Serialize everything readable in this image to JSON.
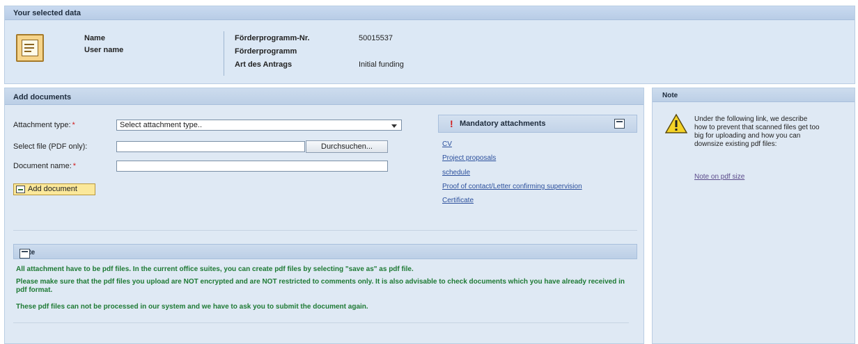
{
  "selected_data": {
    "title": "Your selected data",
    "labels": {
      "name": "Name",
      "user_name": "User name",
      "program_nr": "Förderprogramm-Nr.",
      "program": "Förderprogramm",
      "request_type": "Art des Antrags"
    },
    "values": {
      "program_nr": "50015537",
      "request_type": "Initial funding"
    },
    "icon": "application-form-icon"
  },
  "add_documents": {
    "title": "Add documents",
    "attachment_type_label": "Attachment type:",
    "attachment_type_value": "Select attachment type..",
    "select_file_label": "Select file (PDF only):",
    "browse_label": "Durchsuchen...",
    "document_name_label": "Document name:",
    "required_marker": "*",
    "add_document_label": "Add document"
  },
  "mandatory": {
    "marker": "!",
    "title": "Mandatory attachments",
    "links": [
      "CV",
      "Project proposals",
      "schedule",
      "Proof of contact/Letter confirming supervision",
      "Certificate"
    ]
  },
  "note_inner": {
    "title": "Note",
    "lines": [
      "All attachment have to be pdf files. In the current office suites, you can create pdf files by selecting \"save as\" as pdf file.",
      "Please make sure that the pdf files you upload are NOT encrypted and are NOT restricted to comments only. It is also advisable to check documents which you have already received in pdf format.",
      "These pdf files can not be processed in our system and we have to ask you to submit the document again."
    ]
  },
  "note_right": {
    "title": "Note",
    "text": "Under the following link, we describe how to prevent that scanned files get too big for uploading and how you can downsize existing pdf files:",
    "link": "Note on pdf size",
    "icon": "warning-icon"
  },
  "colors": {
    "panel_bg": "#dce8f5",
    "note_text": "#1e7a34",
    "required": "#d11a1a",
    "link": "#2b4f9c"
  }
}
